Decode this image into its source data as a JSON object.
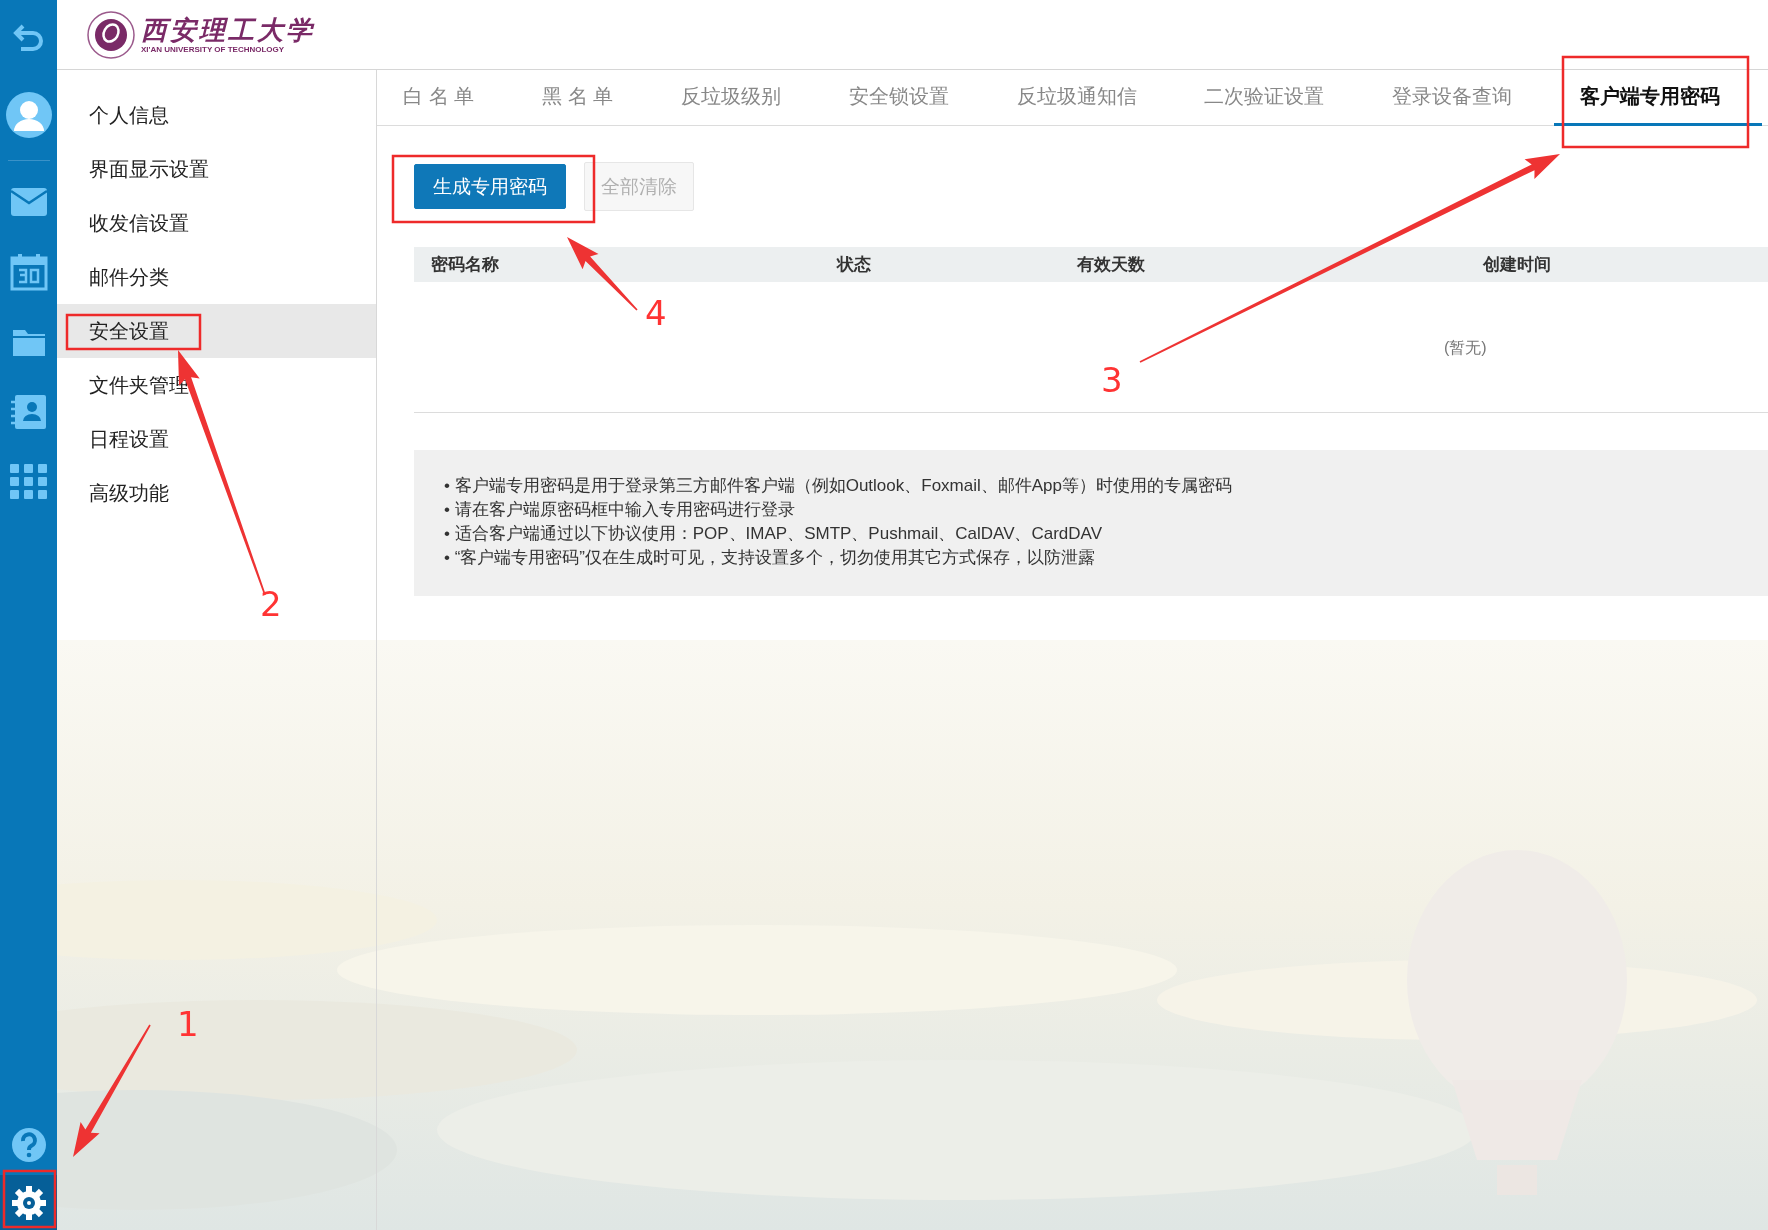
{
  "logo": {
    "name": "西安理工大学",
    "subtitle": "XI'AN UNIVERSITY OF TECHNOLOGY"
  },
  "sidebar": {
    "items": [
      {
        "label": "个人信息",
        "selected": false
      },
      {
        "label": "界面显示设置",
        "selected": false
      },
      {
        "label": "收发信设置",
        "selected": false
      },
      {
        "label": "邮件分类",
        "selected": false
      },
      {
        "label": "安全设置",
        "selected": true
      },
      {
        "label": "文件夹管理",
        "selected": false
      },
      {
        "label": "日程设置",
        "selected": false
      },
      {
        "label": "高级功能",
        "selected": false
      }
    ]
  },
  "tabs": [
    {
      "label": "白 名 单",
      "selected": false
    },
    {
      "label": "黑 名 单",
      "selected": false
    },
    {
      "label": "反垃圾级别",
      "selected": false
    },
    {
      "label": "安全锁设置",
      "selected": false
    },
    {
      "label": "反垃圾通知信",
      "selected": false
    },
    {
      "label": "二次验证设置",
      "selected": false
    },
    {
      "label": "登录设备查询",
      "selected": false
    },
    {
      "label": "客户端专用密码",
      "selected": true
    }
  ],
  "buttons": [
    {
      "label": "生成专用密码",
      "disabled": false
    },
    {
      "label": "全部清除",
      "disabled": true
    }
  ],
  "table": {
    "columns": [
      "密码名称",
      "状态",
      "有效天数",
      "创建时间"
    ],
    "empty_text": "(暂无)"
  },
  "notes": [
    "• 客户端专用密码是用于登录第三方邮件客户端（例如Outlook、Foxmail、邮件App等）时使用的专属密码",
    "• 请在客户端原密码框中输入专用密码进行登录",
    "• 适合客户端通过以下协议使用：POP、IMAP、SMTP、Pushmail、CalDAV、CardDAV",
    "•  “客户端专用密码”仅在生成时可见，支持设置多个，切勿使用其它方式保存，以防泄露"
  ],
  "annotations": [
    "1",
    "2",
    "3",
    "4"
  ]
}
